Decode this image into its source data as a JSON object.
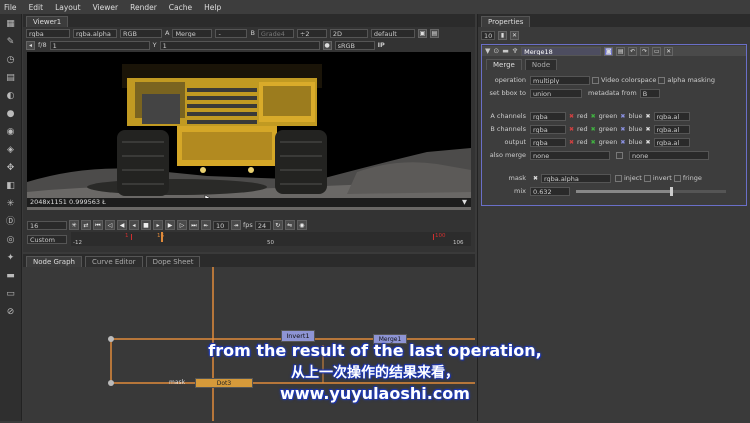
{
  "menubar": [
    "File",
    "Edit",
    "Layout",
    "Viewer",
    "Render",
    "Cache",
    "Help"
  ],
  "viewer": {
    "tab": "Viewer1",
    "channels": "rgba",
    "alpha": "rgba.alpha",
    "rgb": "RGB",
    "a_label": "A",
    "a_input": "Merge",
    "b_label": "B",
    "b_input": "Grade4",
    "proxy": "÷2",
    "mode": "2D",
    "lut": "default",
    "fstop": "f/8",
    "gain": "1",
    "y_label": "Y",
    "gamma": "1",
    "colorspace": "sRGB",
    "ip": "IP",
    "info": "2048x1151 0.999563 Ł",
    "frame": "16",
    "step": "10",
    "fps_label": "fps",
    "fps": "24",
    "range": "Custom",
    "tl_start": "-12",
    "tl_mid": "50",
    "tl_end": "106",
    "tl_marker": "16",
    "tl_in": "1",
    "tl_out": "100"
  },
  "nodegraph": {
    "tabs": [
      "Node Graph",
      "Curve Editor",
      "Dope Sheet"
    ],
    "nodes": {
      "invert": "Invert1",
      "merge": "Merge1",
      "dot": "Dot3"
    },
    "mask_label": "mask"
  },
  "props": {
    "tab": "Properties",
    "count": "10",
    "node_name": "Merge18",
    "subtabs": [
      "Merge",
      "Node"
    ],
    "operation_label": "operation",
    "operation": "multiply",
    "video_colorspace": "Video colorspace",
    "alpha_masking": "alpha masking",
    "bbox_label": "set bbox to",
    "bbox": "union",
    "metadata_label": "metadata from",
    "metadata": "B",
    "a_channels_label": "A channels",
    "a_channels": "rgba",
    "b_channels_label": "B channels",
    "b_channels": "rgba",
    "output_label": "output",
    "output": "rgba",
    "also_merge_label": "also merge",
    "also_merge": "none",
    "also_merge2": "none",
    "red": "red",
    "green": "green",
    "blue": "blue",
    "alpha_ch": "rgba.al",
    "mask_label": "mask",
    "mask": "rgba.alpha",
    "inject": "inject",
    "invert": "invert",
    "fringe": "fringe",
    "mix_label": "mix",
    "mix": "0.632",
    "mix_value": 0.632
  },
  "subtitles": {
    "en": "from the result of the last operation,",
    "zh": "从上一次操作的结果来看，",
    "url": "www.yuyulaoshi.com"
  },
  "colors": {
    "red": "#d04040",
    "green": "#40b040",
    "blue": "#6a70d8",
    "orange": "#e08a3a",
    "accent": "#6a6fc8"
  }
}
